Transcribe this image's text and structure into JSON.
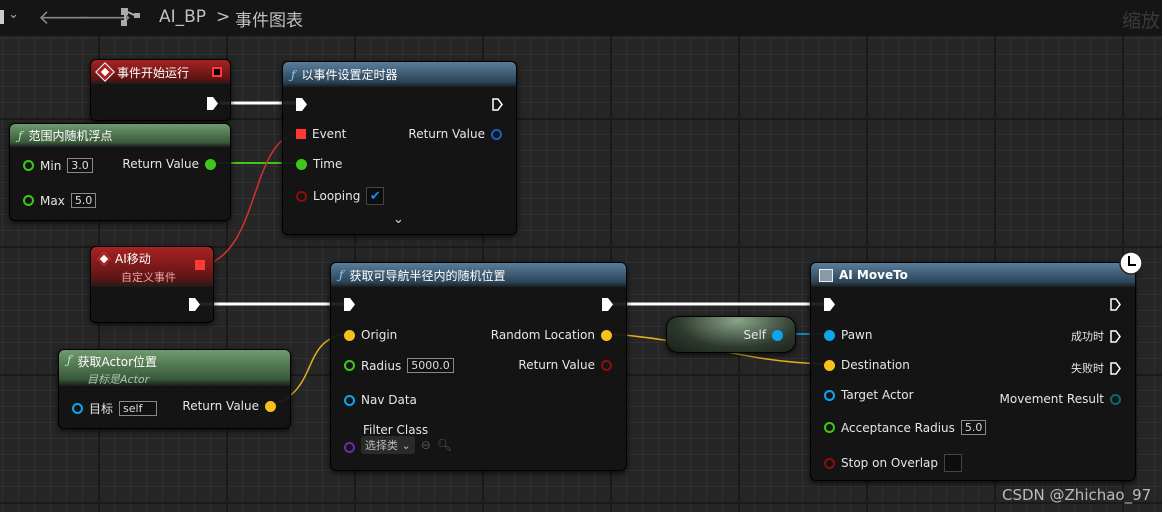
{
  "toolbar": {
    "breadcrumb_root": "AI_BP",
    "breadcrumb_separator": ">",
    "breadcrumb_current": "事件图表",
    "zoom_label": "缩放"
  },
  "nodes": {
    "begin_play": {
      "title": "事件开始运行"
    },
    "set_timer": {
      "title": "以事件设置定时器",
      "event": "Event",
      "time": "Time",
      "looping": "Looping",
      "return_value": "Return Value",
      "looping_checked": true
    },
    "random_float": {
      "title": "范围内随机浮点",
      "min_label": "Min",
      "min_value": "3.0",
      "max_label": "Max",
      "max_value": "5.0",
      "return_value": "Return Value"
    },
    "ai_move_event": {
      "title": "AI移动",
      "subtitle": "自定义事件"
    },
    "random_location": {
      "title": "获取可导航半径内的随机位置",
      "origin": "Origin",
      "radius": "Radius",
      "radius_value": "5000.0",
      "nav_data": "Nav Data",
      "filter_class": "Filter Class",
      "filter_select": "选择类",
      "random_location": "Random Location",
      "return_value": "Return Value"
    },
    "get_actor_location": {
      "title": "获取Actor位置",
      "subtitle": "目标是Actor",
      "target_label": "目标",
      "target_value": "self",
      "return_value": "Return Value"
    },
    "self": {
      "label": "Self"
    },
    "ai_moveto": {
      "title": "AI MoveTo",
      "pawn": "Pawn",
      "destination": "Destination",
      "target_actor": "Target Actor",
      "acceptance_radius": "Acceptance Radius",
      "acceptance_value": "5.0",
      "stop_on_overlap": "Stop on Overlap",
      "on_success": "成功时",
      "on_fail": "失败时",
      "movement_result": "Movement Result"
    }
  },
  "watermark": "CSDN @Zhichao_97",
  "colors": {
    "exec": "#ffffff",
    "float": "#3ec81a",
    "vector": "#f7c11b",
    "object": "#0ea5f0",
    "bool": "#8a0f0f",
    "delegate": "#ff3838",
    "enum": "#0a6a6a",
    "class": "#6a2ab0"
  }
}
